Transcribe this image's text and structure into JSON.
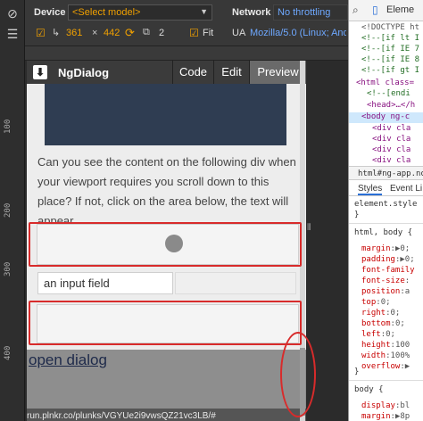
{
  "device": {
    "label": "Device",
    "model_select": "<Select model>",
    "width": "361",
    "height": "442",
    "dpr": "2",
    "fit_label": "Fit",
    "ua_label": "UA",
    "ua_value": "Mozilla/5.0 (Linux; Andro"
  },
  "network": {
    "label": "Network",
    "throttle": "No throttling"
  },
  "ruler": {
    "ticks": [
      "100",
      "200",
      "300",
      "400"
    ]
  },
  "app": {
    "title": "NgDialog",
    "tabs": [
      "Code",
      "Edit",
      "Preview"
    ]
  },
  "content": {
    "paragraph": "Can you see the content on the following div when your viewport requires you scroll down to this place? If not, click on the area below, the text will appear.",
    "input_value": "an input field",
    "link": "open dialog",
    "url": "run.plnkr.co/plunks/VGYUe2i9vwsQZ21vc3LB/#"
  },
  "devtools": {
    "tab_elements": "Eleme",
    "code_lines": [
      "<!DOCTYPE ht",
      "<!--[if lt I",
      "<!--[if IE 7",
      "<!--[if IE 8",
      "<!--[if gt I",
      "<html class=",
      "<!--[endi",
      "<head>…</h",
      "<body ng-c",
      "<div cla",
      "<div cla",
      "<div cla",
      "<div cla"
    ],
    "breadcrumb": "html#ng-app.no-",
    "styles_tab": "Styles",
    "listeners_tab": "Event Li",
    "element_style": "element.style",
    "brace_close": "}",
    "rule_selector": "html, body {",
    "props": [
      {
        "name": "margin",
        "value": "▶0;"
      },
      {
        "name": "padding",
        "value": "▶0;"
      },
      {
        "name": "font-family",
        "value": ""
      },
      {
        "name": "font-size",
        "value": ""
      },
      {
        "name": "position",
        "value": "a"
      },
      {
        "name": "top",
        "value": "0;"
      },
      {
        "name": "right",
        "value": "0;"
      },
      {
        "name": "bottom",
        "value": "0;"
      },
      {
        "name": "left",
        "value": "0;"
      },
      {
        "name": "height",
        "value": "100"
      },
      {
        "name": "width",
        "value": "100%"
      },
      {
        "name": "overflow",
        "value": "▶"
      }
    ],
    "body_selector": "body {",
    "body_props": [
      {
        "name": "display",
        "value": "bl"
      },
      {
        "name": "margin",
        "value": "▶8p"
      }
    ]
  },
  "colors": {
    "accent_orange": "#f0a000",
    "annotation_red": "#d82b2b",
    "devtools_blue": "#2a6fd6"
  }
}
